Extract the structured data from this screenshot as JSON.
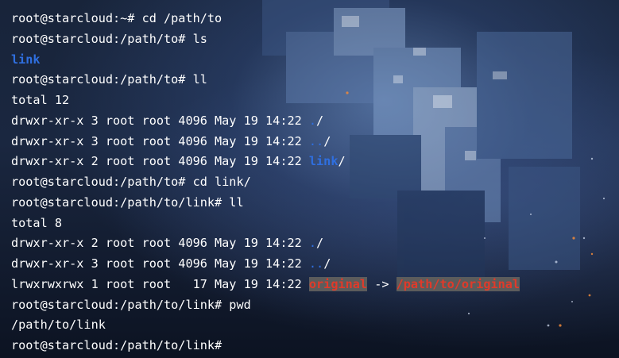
{
  "terminal": {
    "lines": [
      [
        {
          "t": "root@starcloud:~# cd /path/to"
        }
      ],
      [
        {
          "t": "root@starcloud:/path/to# ls"
        }
      ],
      [
        {
          "t": "link",
          "c": "dir"
        }
      ],
      [
        {
          "t": "root@starcloud:/path/to# ll"
        }
      ],
      [
        {
          "t": "total 12"
        }
      ],
      [
        {
          "t": "drwxr-xr-x 3 root root 4096 May 19 14:22 "
        },
        {
          "t": ".",
          "c": "dot"
        },
        {
          "t": "/"
        }
      ],
      [
        {
          "t": "drwxr-xr-x 3 root root 4096 May 19 14:22 "
        },
        {
          "t": "..",
          "c": "dot"
        },
        {
          "t": "/"
        }
      ],
      [
        {
          "t": "drwxr-xr-x 2 root root 4096 May 19 14:22 "
        },
        {
          "t": "link",
          "c": "dir"
        },
        {
          "t": "/"
        }
      ],
      [
        {
          "t": "root@starcloud:/path/to# cd link/"
        }
      ],
      [
        {
          "t": "root@starcloud:/path/to/link# ll"
        }
      ],
      [
        {
          "t": "total 8"
        }
      ],
      [
        {
          "t": "drwxr-xr-x 2 root root 4096 May 19 14:22 "
        },
        {
          "t": ".",
          "c": "dot"
        },
        {
          "t": "/"
        }
      ],
      [
        {
          "t": "drwxr-xr-x 3 root root 4096 May 19 14:22 "
        },
        {
          "t": "..",
          "c": "dot"
        },
        {
          "t": "/"
        }
      ],
      [
        {
          "t": "lrwxrwxrwx 1 root root   17 May 19 14:22 "
        },
        {
          "t": "original",
          "c": "link-hl"
        },
        {
          "t": " -> "
        },
        {
          "t": "/path/to/original",
          "c": "link-hl"
        }
      ],
      [
        {
          "t": "root@starcloud:/path/to/link# pwd"
        }
      ],
      [
        {
          "t": "/path/to/link"
        }
      ],
      [
        {
          "t": "root@starcloud:/path/to/link# "
        }
      ]
    ]
  },
  "colors": {
    "text": "#ffffff",
    "directory": "#2f6fe0",
    "broken_link_fg": "#e03a2a",
    "broken_link_bg": "#5c5c5c"
  }
}
